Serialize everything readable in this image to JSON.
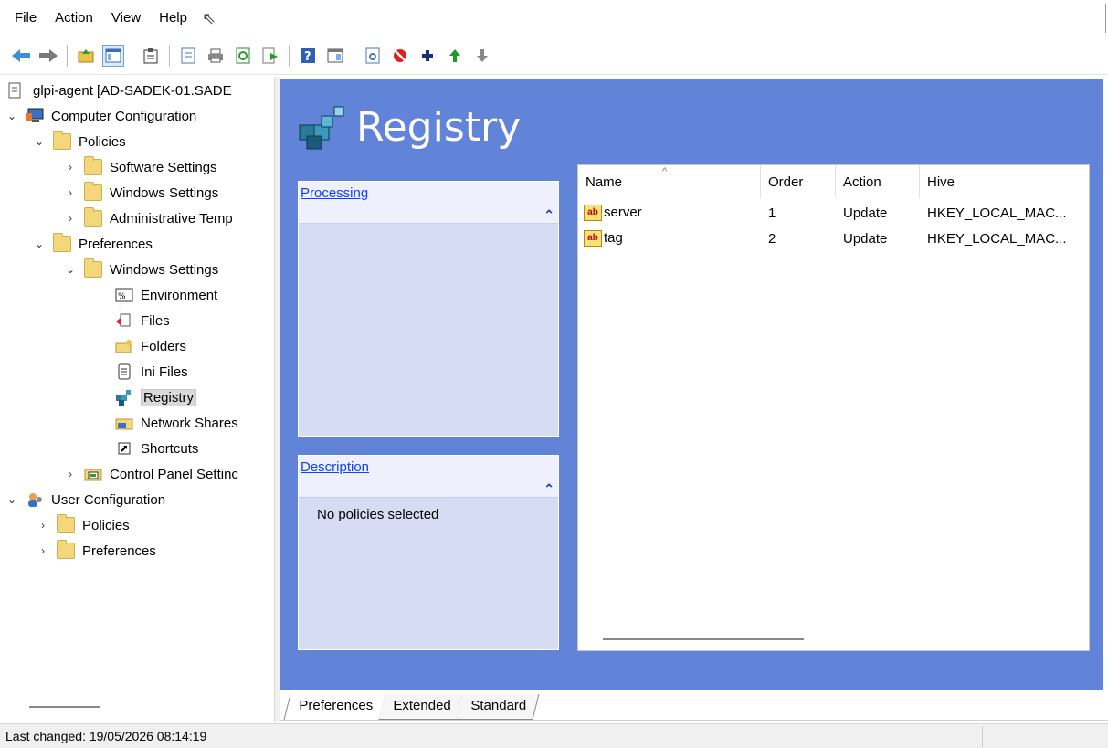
{
  "menu": [
    "File",
    "Action",
    "View",
    "Help"
  ],
  "toolbar": {
    "buttons": [
      "back-icon",
      "forward-icon",
      "up-folder-icon",
      "show-hide-tree-icon",
      "clipboard-icon",
      "properties-icon",
      "print-icon",
      "refresh-icon",
      "export-list-icon",
      "help-icon",
      "console-tree-icon",
      "preview-icon",
      "stop-icon",
      "add-icon",
      "move-up-icon",
      "move-down-icon"
    ]
  },
  "tree": {
    "root": "glpi-agent [AD-SADEK-01.SADE",
    "computer_configuration": "Computer Configuration",
    "policies": "Policies",
    "software_settings": "Software Settings",
    "windows_settings": "Windows Settings",
    "administrative_templates": "Administrative Temp",
    "preferences": "Preferences",
    "pref_windows_settings": "Windows Settings",
    "environment": "Environment",
    "files": "Files",
    "folders": "Folders",
    "ini_files": "Ini Files",
    "registry": "Registry",
    "network_shares": "Network Shares",
    "shortcuts": "Shortcuts",
    "control_panel_settings": "Control Panel Settinc",
    "user_configuration": "User Configuration",
    "user_policies": "Policies",
    "user_preferences": "Preferences"
  },
  "main": {
    "title": "Registry",
    "processing_label": "Processing",
    "description_label": "Description",
    "description_text": "No policies selected"
  },
  "list": {
    "columns": [
      "Name",
      "Order",
      "Action",
      "Hive"
    ],
    "rows": [
      {
        "name": "server",
        "order": "1",
        "action": "Update",
        "hive": "HKEY_LOCAL_MAC..."
      },
      {
        "name": "tag",
        "order": "2",
        "action": "Update",
        "hive": "HKEY_LOCAL_MAC..."
      }
    ]
  },
  "tabs": [
    "Preferences",
    "Extended",
    "Standard"
  ],
  "status": {
    "last_changed": "Last changed: 19/05/2026 08:14:19"
  },
  "colors": {
    "panel_blue": "#6183d8",
    "box_fill": "#d6dcf4",
    "link_blue": "#1040ff"
  }
}
